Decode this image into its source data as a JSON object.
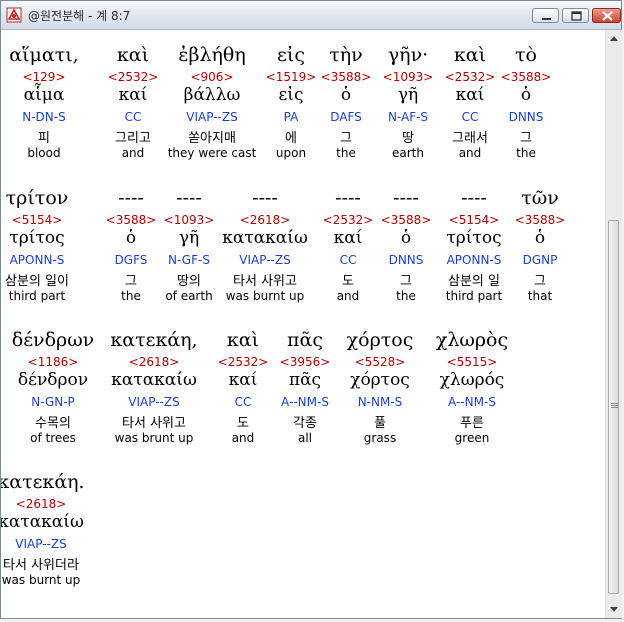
{
  "window": {
    "title": "@원전분해 - 계 8:7"
  },
  "rows": [
    [
      {
        "greek": "αἵματι,",
        "num": "<129>",
        "lemma": "αἷμα",
        "parse": "N-DN-S",
        "kor": "피",
        "eng": "blood"
      },
      {
        "greek": "καὶ",
        "num": "<2532>",
        "lemma": "καί",
        "parse": "CC",
        "kor": "그리고",
        "eng": "and"
      },
      {
        "greek": "ἐβλήθη",
        "num": "<906>",
        "lemma": "βάλλω",
        "parse": "VIAP--ZS",
        "kor": "쏟아지매",
        "eng": "they were cast"
      },
      {
        "greek": "εἰς",
        "num": "<1519>",
        "lemma": "εἰς",
        "parse": "PA",
        "kor": "에",
        "eng": "upon"
      },
      {
        "greek": "τὴν",
        "num": "<3588>",
        "lemma": "ὁ",
        "parse": "DAFS",
        "kor": "그",
        "eng": "the"
      },
      {
        "greek": "γῆν·",
        "num": "<1093>",
        "lemma": "γῆ",
        "parse": "N-AF-S",
        "kor": "땅",
        "eng": "earth"
      },
      {
        "greek": "καὶ",
        "num": "<2532>",
        "lemma": "καί",
        "parse": "CC",
        "kor": "그래서",
        "eng": "and"
      },
      {
        "greek": "τὸ",
        "num": "<3588>",
        "lemma": "ὁ",
        "parse": "DNNS",
        "kor": "그",
        "eng": "the"
      }
    ],
    [
      {
        "greek": "τρίτον",
        "num": "<5154>",
        "lemma": "τρίτος",
        "parse": "APONN-S",
        "kor": "삼분의 일이",
        "eng": "third part"
      },
      {
        "greek": "----",
        "num": "<3588>",
        "lemma": "ὁ",
        "parse": "DGFS",
        "kor": "그",
        "eng": "the"
      },
      {
        "greek": "----",
        "num": "<1093>",
        "lemma": "γῆ",
        "parse": "N-GF-S",
        "kor": "땅의",
        "eng": "of earth"
      },
      {
        "greek": "----",
        "num": "<2618>",
        "lemma": "κατακαίω",
        "parse": "VIAP--ZS",
        "kor": "타서 사위고",
        "eng": "was burnt up"
      },
      {
        "greek": "----",
        "num": "<2532>",
        "lemma": "καί",
        "parse": "CC",
        "kor": "도",
        "eng": "and"
      },
      {
        "greek": "----",
        "num": "<3588>",
        "lemma": "ὁ",
        "parse": "DNNS",
        "kor": "그",
        "eng": "the"
      },
      {
        "greek": "----",
        "num": "<5154>",
        "lemma": "τρίτος",
        "parse": "APONN-S",
        "kor": "삼분의 일",
        "eng": "third part"
      },
      {
        "greek": "τῶν",
        "num": "<3588>",
        "lemma": "ὁ",
        "parse": "DGNP",
        "kor": "그",
        "eng": "that"
      }
    ],
    [
      {
        "greek": "δένδρων",
        "num": "<1186>",
        "lemma": "δένδρον",
        "parse": "N-GN-P",
        "kor": "수목의",
        "eng": "of trees"
      },
      {
        "greek": "κατεκάη,",
        "num": "<2618>",
        "lemma": "κατακαίω",
        "parse": "VIAP--ZS",
        "kor": "타서 사위고",
        "eng": "was brunt up"
      },
      {
        "greek": "καὶ",
        "num": "<2532>",
        "lemma": "καί",
        "parse": "CC",
        "kor": "도",
        "eng": "and"
      },
      {
        "greek": "πᾶς",
        "num": "<3956>",
        "lemma": "πᾶς",
        "parse": "A--NM-S",
        "kor": "각종",
        "eng": "all"
      },
      {
        "greek": "χόρτος",
        "num": "<5528>",
        "lemma": "χόρτος",
        "parse": "N-NM-S",
        "kor": "풀",
        "eng": "grass"
      },
      {
        "greek": "χλωρὸς",
        "num": "<5515>",
        "lemma": "χλωρός",
        "parse": "A--NM-S",
        "kor": "푸른",
        "eng": "green"
      }
    ],
    [
      {
        "greek": "κατεκάη.",
        "num": "<2618>",
        "lemma": "κατακαίω",
        "parse": "VIAP--ZS",
        "kor": "타서 사위더라",
        "eng": "was burnt up"
      }
    ]
  ]
}
